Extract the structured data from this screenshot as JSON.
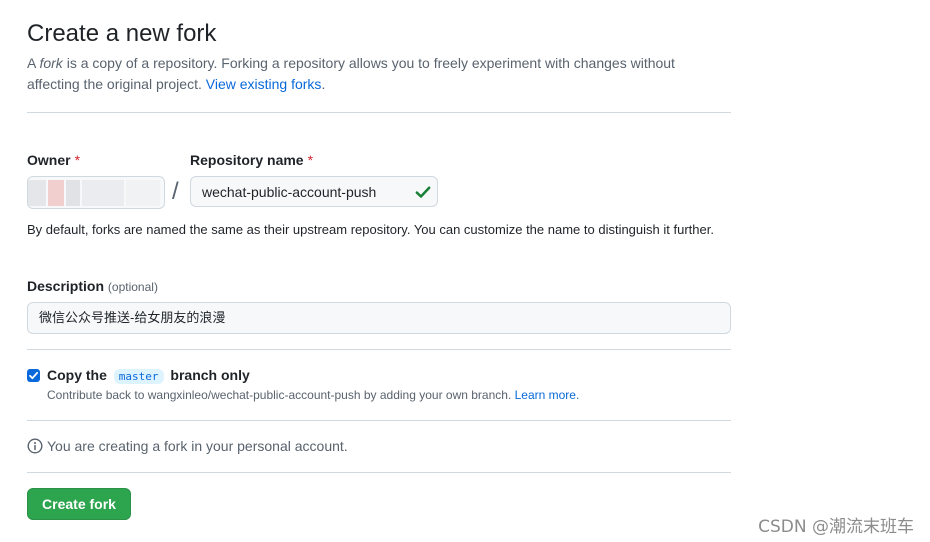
{
  "header": {
    "title": "Create a new fork",
    "lead_pre": "A ",
    "lead_em": "fork",
    "lead_post": " is a copy of a repository. Forking a repository allows you to freely experiment with changes without affecting the original project. ",
    "lead_link": "View existing forks",
    "lead_end": "."
  },
  "owner": {
    "label": "Owner",
    "required_mark": "*"
  },
  "repo": {
    "label": "Repository name",
    "required_mark": "*",
    "value": "wechat-public-account-push",
    "separator": "/",
    "valid_icon": "check-icon"
  },
  "naming_help": "By default, forks are named the same as their upstream repository. You can customize the name to distinguish it further.",
  "description": {
    "label": "Description",
    "optional": "(optional)",
    "value": "微信公众号推送-给女朋友的浪漫"
  },
  "copy_branch": {
    "checked": true,
    "label_pre": "Copy the",
    "branch": "master",
    "label_post": "branch only",
    "note": "Contribute back to wangxinleo/wechat-public-account-push by adding your own branch. ",
    "learn_more": "Learn more."
  },
  "info": {
    "icon": "info-icon",
    "text": "You are creating a fork in your personal account."
  },
  "submit": {
    "label": "Create fork"
  },
  "watermark": "CSDN @潮流末班车",
  "colors": {
    "accent": "#0969da",
    "button": "#2da44e",
    "danger": "#d1242f",
    "success": "#1a7f37"
  }
}
